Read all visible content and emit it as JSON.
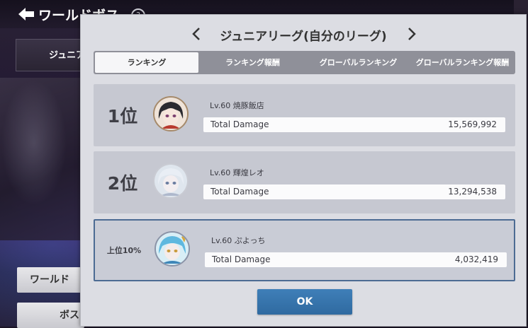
{
  "background": {
    "title": "ワールドボス",
    "tab_label": "ジュニア",
    "button1_label": "ワールド",
    "button2_label": "ボス"
  },
  "modal": {
    "title": "ジュニアリーグ(自分のリーグ)",
    "tabs": [
      {
        "label": "ランキング",
        "active": true
      },
      {
        "label": "ランキング報酬",
        "active": false
      },
      {
        "label": "グローバルランキング",
        "active": false
      },
      {
        "label": "グローバルランキング報酬",
        "active": false
      }
    ],
    "entries": [
      {
        "rank": "1位",
        "name": "Lv.60 焼豚飯店",
        "damage_label": "Total Damage",
        "damage": "15,569,992"
      },
      {
        "rank": "2位",
        "name": "Lv.60 輝煌レオ",
        "damage_label": "Total Damage",
        "damage": "13,294,538"
      },
      {
        "rank": "上位10%",
        "name": "Lv.60 ぷよっち",
        "damage_label": "Total Damage",
        "damage": "4,032,419"
      }
    ],
    "ok_label": "OK"
  },
  "colors": {
    "modal_bg": "#dcdde3",
    "card_bg": "#c6c8d1",
    "highlight_border": "#4c6b93",
    "ok_button": "#3674aa"
  }
}
